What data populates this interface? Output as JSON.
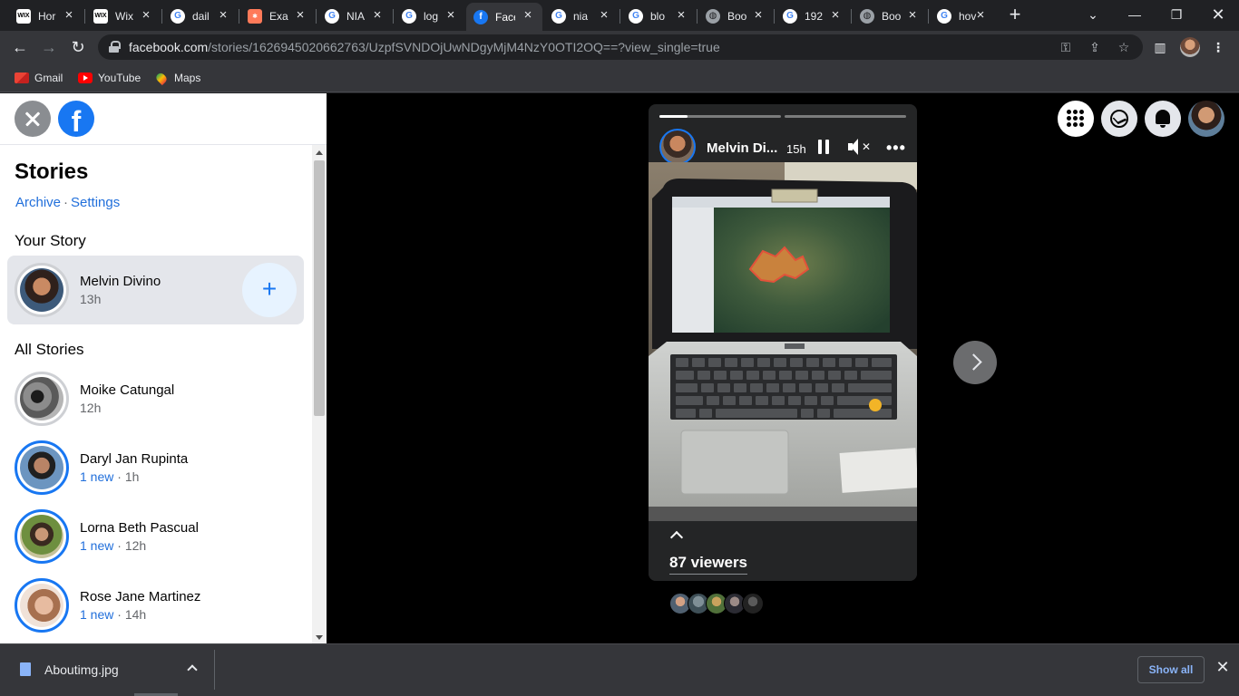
{
  "browser": {
    "tabs": [
      {
        "title": "Hor",
        "favicon": "wix-icon",
        "active": false
      },
      {
        "title": "Wix",
        "favicon": "wix-icon",
        "active": false
      },
      {
        "title": "dail",
        "favicon": "google-icon",
        "active": false
      },
      {
        "title": "Exa",
        "favicon": "hubspot-icon",
        "active": false
      },
      {
        "title": "NIA",
        "favicon": "google-icon",
        "active": false
      },
      {
        "title": "log",
        "favicon": "google-icon",
        "active": false
      },
      {
        "title": "Face",
        "favicon": "facebook-icon",
        "active": true
      },
      {
        "title": "nia",
        "favicon": "google-icon",
        "active": false
      },
      {
        "title": "blo",
        "favicon": "google-icon",
        "active": false
      },
      {
        "title": "Boo",
        "favicon": "globe-icon",
        "active": false
      },
      {
        "title": "192",
        "favicon": "google-icon",
        "active": false
      },
      {
        "title": "Boo",
        "favicon": "globe-icon",
        "active": false
      },
      {
        "title": "hov",
        "favicon": "google-icon",
        "active": false
      }
    ],
    "url_host": "facebook.com",
    "url_path": "/stories/1626945020662763/UzpfSVNDOjUwNDgyMjM4NzY0OTI2OQ==?view_single=true",
    "bookmarks": [
      {
        "label": "Gmail",
        "icon": "gmail-icon"
      },
      {
        "label": "YouTube",
        "icon": "youtube-icon"
      },
      {
        "label": "Maps",
        "icon": "maps-icon"
      }
    ]
  },
  "sidebar": {
    "title": "Stories",
    "links": {
      "archive": "Archive",
      "separator": "·",
      "settings": "Settings"
    },
    "your_story_heading": "Your Story",
    "your_story": {
      "name": "Melvin Divino",
      "time": "13h"
    },
    "all_stories_heading": "All Stories",
    "stories": [
      {
        "name": "Moike Catungal",
        "new": "",
        "time": "12h"
      },
      {
        "name": "Daryl Jan Rupinta",
        "new": "1 new",
        "time": "1h"
      },
      {
        "name": "Lorna Beth Pascual",
        "new": "1 new",
        "time": "12h"
      },
      {
        "name": "Rose Jane Martinez",
        "new": "1 new",
        "time": "14h"
      }
    ],
    "dot": " · "
  },
  "viewer": {
    "author": "Melvin Di...",
    "time": "15h",
    "segments": 2,
    "progress_first": 0.23,
    "viewers_label": "87 viewers"
  },
  "download_bar": {
    "filename": "Aboutimg.jpg",
    "show_all": "Show all"
  },
  "colors": {
    "facebook_blue": "#1877f2",
    "link_blue": "#216fdb",
    "chrome_dark": "#202124",
    "chrome_toolbar": "#35363a"
  }
}
